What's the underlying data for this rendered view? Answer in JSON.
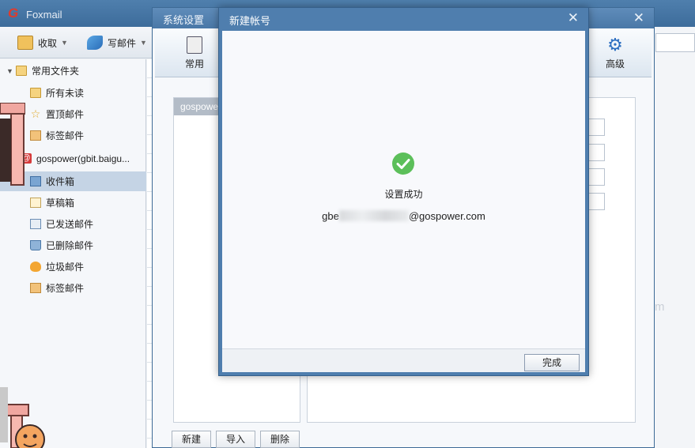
{
  "app": {
    "title": "Foxmail",
    "toolbar": {
      "receive_label": "收取",
      "compose_label": "写邮件"
    },
    "right_strip_text": "m"
  },
  "sidebar": {
    "items": [
      {
        "label": "常用文件夹"
      },
      {
        "label": "所有未读"
      },
      {
        "label": "置顶邮件"
      },
      {
        "label": "标签邮件"
      },
      {
        "label": "gospower(gbit.baigu..."
      },
      {
        "label": "收件箱"
      },
      {
        "label": "草稿箱"
      },
      {
        "label": "已发送邮件"
      },
      {
        "label": "已删除邮件"
      },
      {
        "label": "垃圾邮件"
      },
      {
        "label": "标签邮件"
      }
    ]
  },
  "settings": {
    "title": "系统设置",
    "tabs": {
      "general": "常用",
      "advanced": "高级"
    },
    "account_list_item": "gospower",
    "buttons": {
      "new": "新建",
      "import": "导入",
      "delete": "删除"
    }
  },
  "new_account": {
    "title": "新建帐号",
    "success_text": "设置成功",
    "email_prefix": "gbe",
    "email_domain": "@gospower.com",
    "finish_label": "完成"
  },
  "colors": {
    "titlebar": "#4a78a7",
    "success": "#5cbf5a",
    "selection": "#c5d4e5"
  }
}
